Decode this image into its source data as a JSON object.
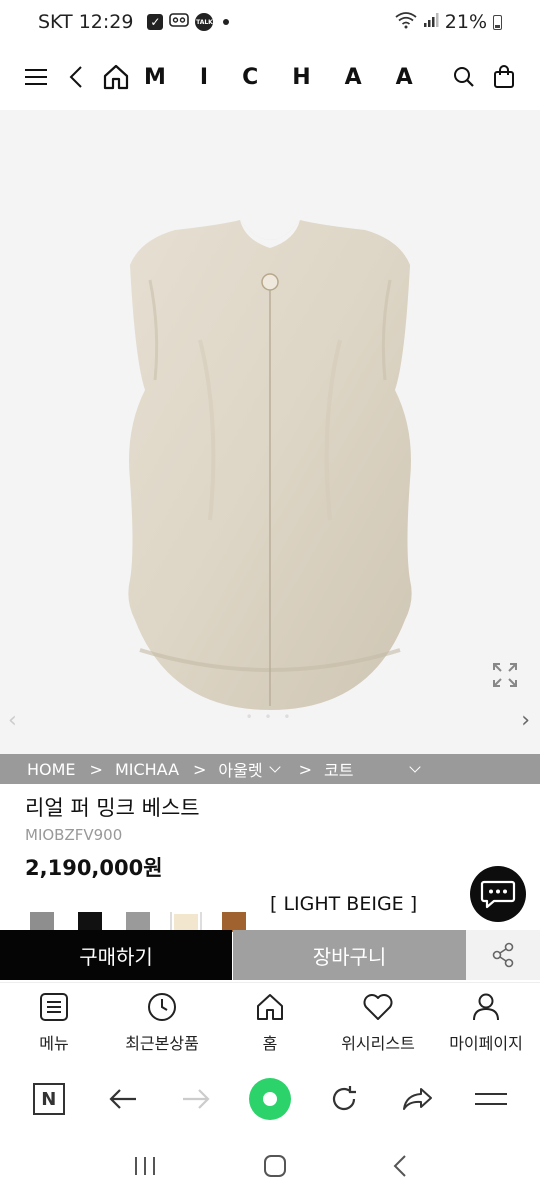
{
  "status_bar": {
    "carrier_time": "SKT 12:29",
    "talk_badge": "TALK",
    "battery": "21%"
  },
  "header": {
    "logo": "MICHAA",
    "icons": [
      "menu-icon",
      "back-icon",
      "home-icon",
      "search-icon",
      "shopping-bag-icon"
    ]
  },
  "breadcrumb": {
    "home": "HOME",
    "sep": ">",
    "brand": "MICHAA",
    "category": "아울렛",
    "subcategory": "코트"
  },
  "product": {
    "title": "리얼 퍼 밍크 베스트",
    "code": "MIOBZFV900",
    "price": "2,190,000원",
    "color_label": "[ LIGHT BEIGE ]",
    "swatch_colors": [
      "#8e8e8e",
      "#111111",
      "#9a9a9a",
      "#f2e6cf",
      "#a0622e"
    ]
  },
  "buy_bar": {
    "buy": "구매하기",
    "cart": "장바구니"
  },
  "bottom_nav": {
    "items": [
      {
        "label": "메뉴",
        "icon": "menu-list-icon"
      },
      {
        "label": "최근본상품",
        "icon": "clock-icon"
      },
      {
        "label": "홈",
        "icon": "home-icon"
      },
      {
        "label": "위시리스트",
        "icon": "heart-icon"
      },
      {
        "label": "마이페이지",
        "icon": "user-icon"
      }
    ]
  },
  "browser_toolbar": {
    "n_label": "N"
  },
  "colors": {
    "image_bg": "#f4f4f4",
    "breadcrumb_bg": "#9a9a9a",
    "buy_bg": "#050505",
    "cart_bg": "#a0a0a0",
    "accent_green": "#2bd36a"
  }
}
